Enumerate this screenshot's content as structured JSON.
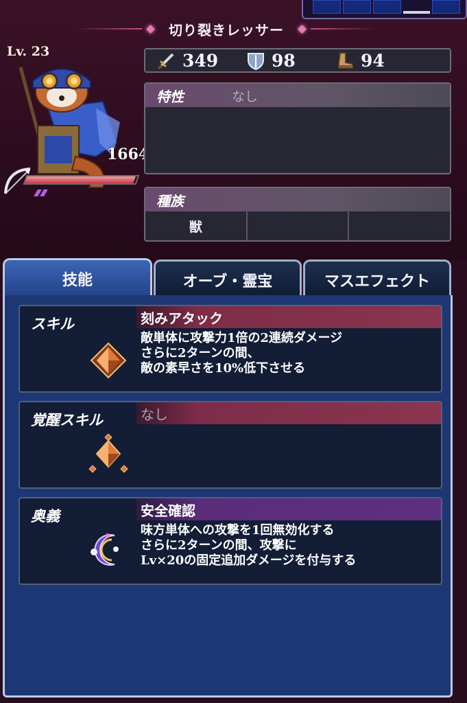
{
  "header": {
    "title": "切り裂きレッサー"
  },
  "unit": {
    "level": "Lv. 23",
    "hp": "1664",
    "hp_fraction": 0.98,
    "gauge_count": 2
  },
  "stats": {
    "attack": "349",
    "defense": "98",
    "speed": "94"
  },
  "trait": {
    "label": "特性",
    "value": "なし"
  },
  "race": {
    "label": "種族",
    "values": [
      "獣",
      "",
      ""
    ]
  },
  "tabs": [
    {
      "label": "技能",
      "active": true
    },
    {
      "label": "オーブ・霊宝",
      "active": false
    },
    {
      "label": "マスエフェクト",
      "active": false
    }
  ],
  "skills": [
    {
      "kind": "スキル",
      "name": "刻みアタック",
      "desc": "敵単体に攻撃力1倍の2連続ダメージ\nさらに2ターンの間、\n敵の素早さを10%低下させる",
      "icon": "skill-crystal-icon"
    },
    {
      "kind": "覚醒スキル",
      "name": "なし",
      "desc": "",
      "icon": "awakened-skill-crystal-icon"
    },
    {
      "kind": "奥義",
      "name": "安全確認",
      "desc": "味方単体への攻撃を1回無効化する\nさらに2ターンの間、攻撃に\nLv×20の固定追加ダメージを付与する",
      "icon": "ultimate-moon-icon"
    }
  ],
  "colors": {
    "background": "#2a0d1e",
    "panel": "#262733",
    "skill_bar_red": "#8a3550",
    "skill_bar_purple": "#5f2f80",
    "tab_active": "#3d64b6",
    "main_panel": "#1c3774"
  }
}
